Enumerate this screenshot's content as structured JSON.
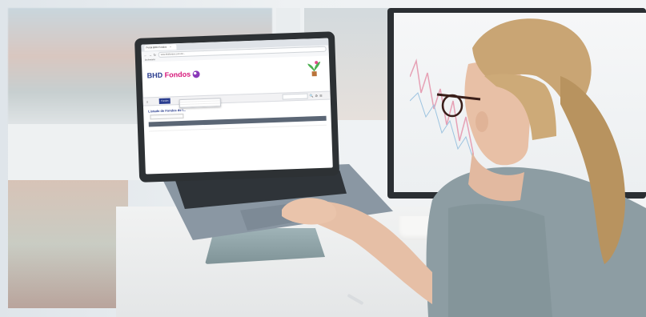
{
  "browser": {
    "tab_title": "Portal BHD Fondos",
    "tab_close": "×",
    "nav_back": "←",
    "nav_forward": "→",
    "nav_reload": "↻",
    "url": "www.bhdfondos.com.do/...",
    "bookmarks": "Bookmarks"
  },
  "site": {
    "logo_text_main": "BHD ",
    "logo_text_accent": "Fondos",
    "contact_lines": [
      "",
      "",
      "",
      ""
    ],
    "promo_text": "",
    "nav": {
      "home_icon": "⌂",
      "items": [
        "",
        "",
        "Fondos",
        ""
      ],
      "active_index": 2,
      "icons": [
        "🔍",
        "⚙",
        "☰"
      ],
      "login": ""
    },
    "dropdown_items": [
      "",
      "",
      ""
    ],
    "page_title": "Listado de Fondos de I...",
    "filter_label": "",
    "filter_button": "",
    "table_headers": [
      "",
      "",
      "",
      "",
      ""
    ],
    "table_rows": [
      [
        "",
        "",
        "",
        "",
        ""
      ]
    ],
    "footer": ""
  }
}
